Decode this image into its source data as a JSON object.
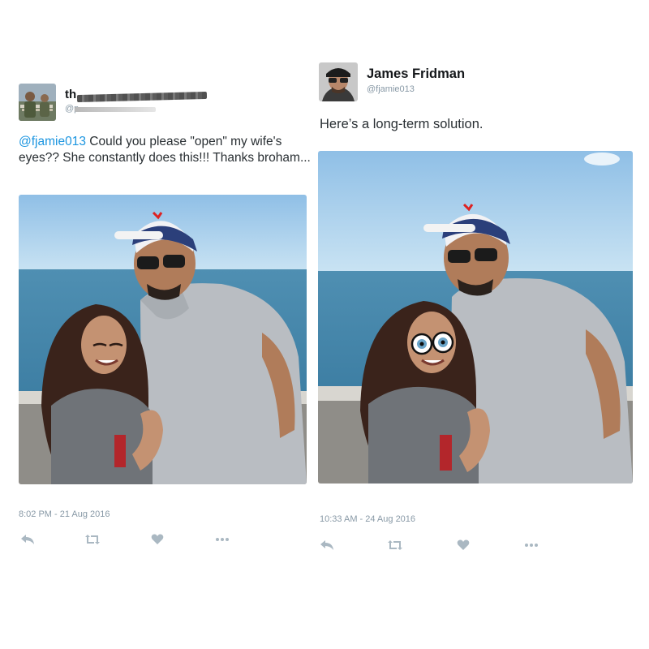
{
  "left_tweet": {
    "display_name_visible_fragment": "th",
    "handle_visible_fragment": "@p",
    "text_mention": "@fjamie013",
    "text_body": " Could you please \"open\" my wife's eyes?? She constantly does this!!! Thanks broham...",
    "timestamp": "8:02 PM - 21 Aug 2016",
    "actions": [
      "reply-icon",
      "retweet-icon",
      "like-icon",
      "more-icon"
    ]
  },
  "right_tweet": {
    "display_name": "James Fridman",
    "handle": "@fjamie013",
    "text": "Here’s a long-term solution.",
    "timestamp": "10:33 AM - 24 Aug 2016",
    "actions": [
      "reply-icon",
      "retweet-icon",
      "like-icon",
      "more-icon"
    ]
  },
  "colors": {
    "mention": "#1b95e0",
    "secondary_text": "#8899a6",
    "action_icons": "#aab8c2"
  }
}
